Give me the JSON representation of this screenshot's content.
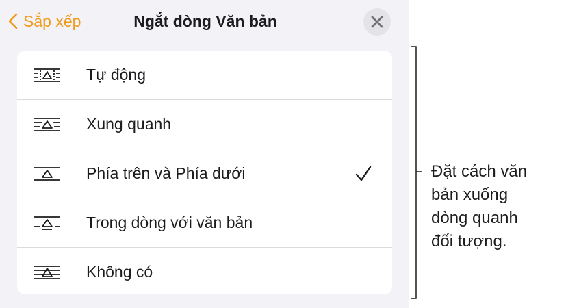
{
  "header": {
    "back_label": "Sắp xếp",
    "title": "Ngắt dòng Văn bản"
  },
  "options": [
    {
      "label": "Tự động",
      "icon": "wrap-auto-icon",
      "selected": false
    },
    {
      "label": "Xung quanh",
      "icon": "wrap-around-icon",
      "selected": false
    },
    {
      "label": "Phía trên và Phía dưới",
      "icon": "wrap-above-below-icon",
      "selected": true
    },
    {
      "label": "Trong dòng với văn bản",
      "icon": "wrap-inline-icon",
      "selected": false
    },
    {
      "label": "Không có",
      "icon": "wrap-none-icon",
      "selected": false
    }
  ],
  "callout": {
    "lines": [
      "Đặt cách văn",
      "bản xuống",
      "dòng quanh",
      "đối tượng."
    ]
  },
  "colors": {
    "accent": "#f09a1a",
    "panel_bg": "#f2f2f7",
    "text": "#1c1c1e"
  }
}
